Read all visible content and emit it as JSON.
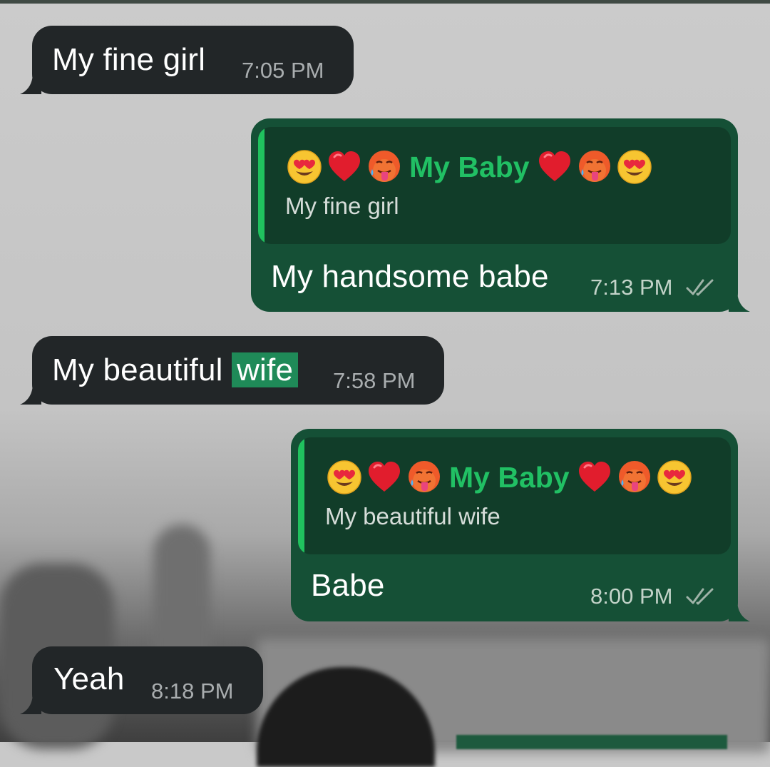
{
  "messages": [
    {
      "direction": "incoming",
      "text": "My fine girl",
      "time": "7:05 PM"
    },
    {
      "direction": "outgoing",
      "reply_to": {
        "sender": "My Baby",
        "sender_emojis": [
          "heart-eyes",
          "red-heart",
          "hot-face",
          "sender-name",
          "red-heart",
          "hot-face",
          "heart-eyes"
        ],
        "text": "My fine girl"
      },
      "text": "My handsome babe",
      "time": "7:13 PM",
      "status": "read"
    },
    {
      "direction": "incoming",
      "text_before": "My beautiful",
      "text_highlight": "wife",
      "time": "7:58 PM"
    },
    {
      "direction": "outgoing",
      "reply_to": {
        "sender": "My Baby",
        "text": "My beautiful wife"
      },
      "text": "Babe",
      "time": "8:00 PM",
      "status": "read"
    },
    {
      "direction": "incoming",
      "text": "Yeah",
      "time": "8:18 PM"
    }
  ],
  "icons": {
    "emoji_left": [
      "heart-eyes-emoji",
      "red-heart-emoji",
      "hot-face-emoji"
    ],
    "emoji_right": [
      "red-heart-emoji",
      "hot-face-emoji",
      "heart-eyes-emoji"
    ],
    "read_receipt": "double-check-icon"
  },
  "colors": {
    "incoming_bubble": "#222628",
    "outgoing_bubble": "#155036",
    "quote_background": "#113d29",
    "quote_accent": "#20c25e",
    "sender_name": "#21c064",
    "highlight": "#1f8a58"
  }
}
